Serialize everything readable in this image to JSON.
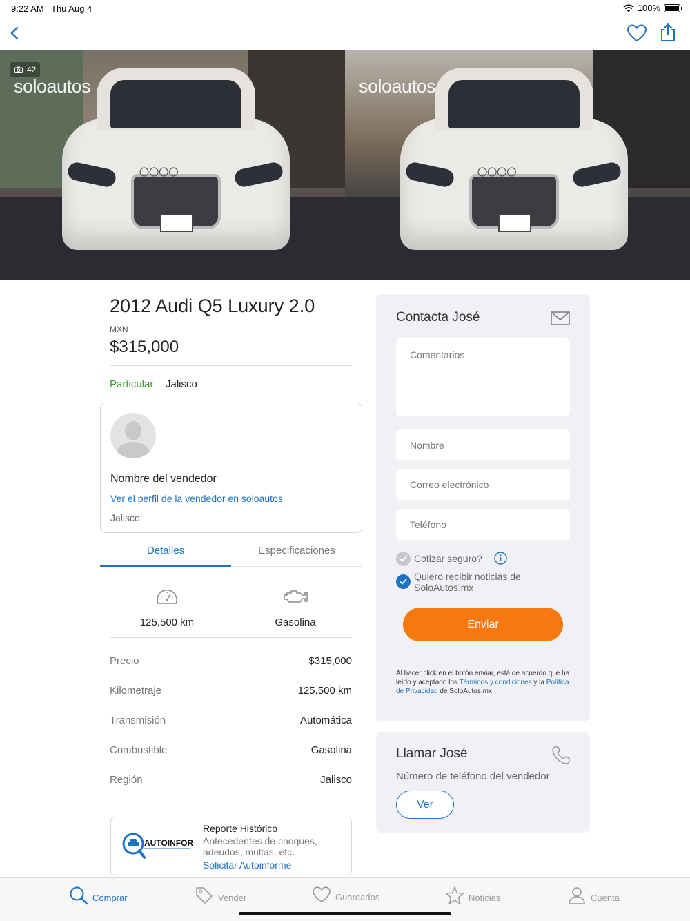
{
  "status_bar": {
    "time": "9:22 AM",
    "date": "Thu Aug 4",
    "battery": "100%"
  },
  "gallery": {
    "photo_count": "42",
    "watermark": "soloautos"
  },
  "listing": {
    "title": "2012 Audi Q5 Luxury 2.0",
    "currency": "MXN",
    "price": "$315,000",
    "seller_type": "Particular",
    "region": "Jalisco"
  },
  "seller": {
    "name": "Nombre del vendedor",
    "profile_link": "Ver el perfil de la vendedor en soloautos",
    "region": "Jalisco"
  },
  "tabs": [
    {
      "label": "Detalles",
      "active": true
    },
    {
      "label": "Especificaciones",
      "active": false
    }
  ],
  "features": {
    "mileage": "125,500 km",
    "fuel": "Gasolina"
  },
  "specs": [
    {
      "key": "Precio",
      "value": "$315,000"
    },
    {
      "key": "Kilometraje",
      "value": "125,500 km"
    },
    {
      "key": "Transmisión",
      "value": "Automática"
    },
    {
      "key": "Combustible",
      "value": "Gasolina"
    },
    {
      "key": "Región",
      "value": "Jalisco"
    }
  ],
  "report": {
    "logo_text": "AUTOINFORME",
    "title": "Reporte Histórico",
    "description": "Antecedentes de choques, adeudos, multas, etc.",
    "link": "Solicitar Autoinforme"
  },
  "contact": {
    "title": "Contacta José",
    "comments_placeholder": "Comentarios",
    "name_placeholder": "Nombre",
    "email_placeholder": "Correo electrónico",
    "phone_placeholder": "Teléfono",
    "insurance_label": "Cotizar seguro?",
    "newsletter_label": "Quiero recibir noticias de SoloAutos.mx",
    "send_label": "Enviar",
    "legal_pre": "Al hacer click en el botón enviar, está de acuerdo que ha leído y aceptado los ",
    "legal_terms": "Términos y condiciones",
    "legal_mid": " y la ",
    "legal_privacy": "Política de Privacidad",
    "legal_post": " de SoloAutos.mx"
  },
  "call": {
    "title": "Llamar José",
    "subtitle": "Número de teléfono del vendedor",
    "button": "Ver"
  },
  "tab_bar": [
    {
      "label": "Comprar",
      "icon": "search-icon",
      "active": true
    },
    {
      "label": "Vender",
      "icon": "tag-icon",
      "active": false
    },
    {
      "label": "Guardados",
      "icon": "heart-icon",
      "active": false
    },
    {
      "label": "Noticias",
      "icon": "star-icon",
      "active": false
    },
    {
      "label": "Cuenta",
      "icon": "user-icon",
      "active": false
    }
  ],
  "colors": {
    "accent": "#1d72c4",
    "cta": "#f7780f",
    "private_seller": "#3a9a2a"
  }
}
